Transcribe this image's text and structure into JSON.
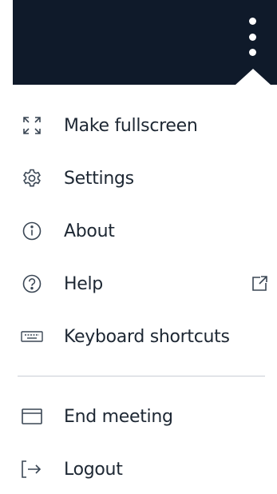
{
  "menu": {
    "items": [
      {
        "label": "Make fullscreen",
        "icon": "fullscreen-icon"
      },
      {
        "label": "Settings",
        "icon": "gear-icon"
      },
      {
        "label": "About",
        "icon": "info-icon"
      },
      {
        "label": "Help",
        "icon": "help-icon",
        "external": "external-link-icon"
      },
      {
        "label": "Keyboard shortcuts",
        "icon": "keyboard-icon"
      },
      {
        "label": "End meeting",
        "icon": "window-icon"
      },
      {
        "label": "Logout",
        "icon": "logout-icon"
      }
    ]
  },
  "colors": {
    "topbar": "#0f1a2a",
    "text": "#1d2733",
    "icon": "#3a4654",
    "divider": "#c9ced5"
  }
}
